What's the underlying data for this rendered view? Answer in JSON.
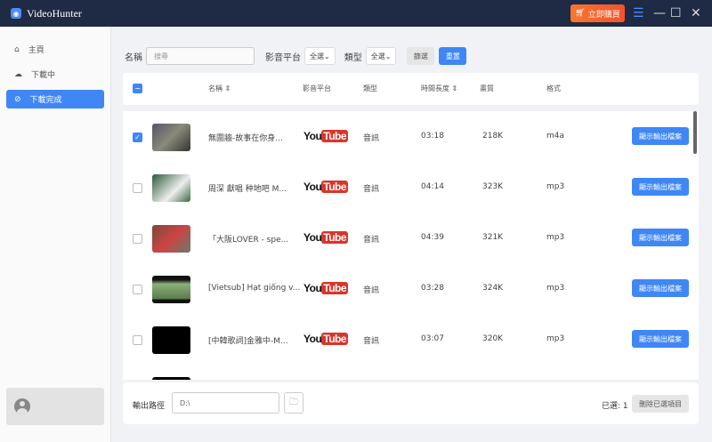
{
  "app": {
    "title": "VideoHunter",
    "buy_label": "立即購買"
  },
  "sidebar": {
    "items": [
      {
        "label": "主頁",
        "icon": "home-icon"
      },
      {
        "label": "下載中",
        "icon": "cloud-download-icon"
      },
      {
        "label": "下載完成",
        "icon": "check-circle-icon"
      }
    ],
    "active": 2
  },
  "filters": {
    "name_label": "名稱",
    "search_placeholder": "搜尋",
    "platform_label": "影音平台",
    "platform_value": "全選",
    "type_label": "類型",
    "type_value": "全選",
    "filter_button": "篩選",
    "reset_button": "重置"
  },
  "table": {
    "headers": {
      "name": "名稱",
      "platform": "影音平台",
      "type": "類型",
      "duration": "時間長度",
      "quality": "畫質",
      "format": "格式"
    },
    "rows": [
      {
        "checked": true,
        "title": "無圍牆-故事在你身...",
        "platform": "YouTube",
        "type": "音訊",
        "duration": "03:18",
        "quality": "218K",
        "format": "m4a",
        "action": "顯示輸出檔案"
      },
      {
        "checked": false,
        "title": "周深 獻唱 种地吧 M...",
        "platform": "YouTube",
        "type": "音訊",
        "duration": "04:14",
        "quality": "323K",
        "format": "mp3",
        "action": "顯示輸出檔案"
      },
      {
        "checked": false,
        "title": "「大阪LOVER - spe...",
        "platform": "YouTube",
        "type": "音訊",
        "duration": "04:39",
        "quality": "321K",
        "format": "mp3",
        "action": "顯示輸出檔案"
      },
      {
        "checked": false,
        "title": "[Vietsub] Hạt giống v...",
        "platform": "YouTube",
        "type": "音訊",
        "duration": "03:28",
        "quality": "324K",
        "format": "mp3",
        "action": "顯示輸出檔案"
      },
      {
        "checked": false,
        "title": "[中韓歌詞]金雅中-M...",
        "platform": "YouTube",
        "type": "音訊",
        "duration": "03:07",
        "quality": "320K",
        "format": "mp3",
        "action": "顯示輸出檔案"
      }
    ]
  },
  "footer": {
    "output_label": "輸出路徑",
    "output_path": "D:\\",
    "selected_label": "已選: 1",
    "delete_button": "刪除已選項目"
  },
  "colors": {
    "accent": "#3f87f5",
    "titlebar": "#1f2a44",
    "buy": "#f4622b"
  }
}
